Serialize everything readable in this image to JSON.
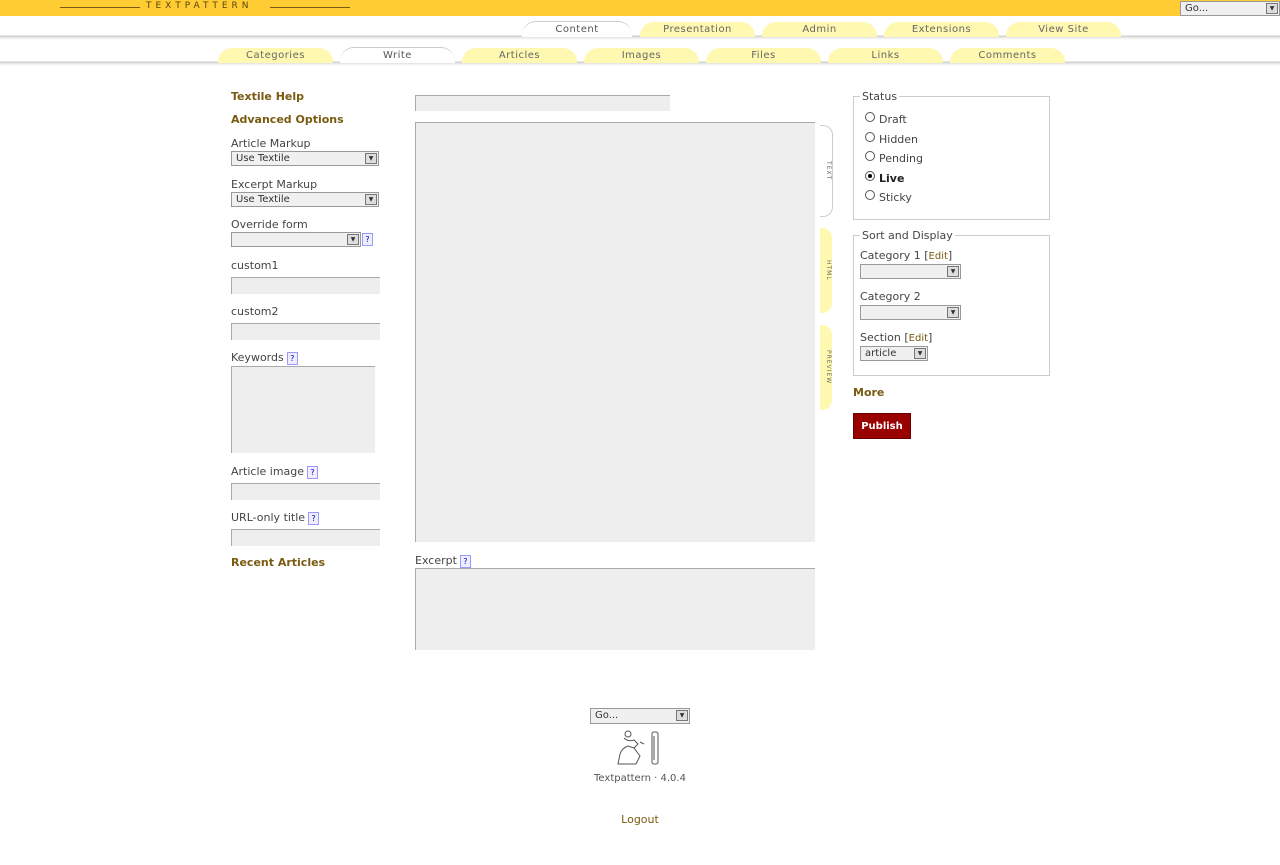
{
  "brand": "Textpattern",
  "top_go": "Go...",
  "tabs_primary": [
    {
      "label": "Content",
      "active": true
    },
    {
      "label": "Presentation"
    },
    {
      "label": "Admin"
    },
    {
      "label": "Extensions"
    },
    {
      "label": "View Site"
    }
  ],
  "tabs_secondary": [
    {
      "label": "Categories"
    },
    {
      "label": "Write",
      "active": true
    },
    {
      "label": "Articles"
    },
    {
      "label": "Images"
    },
    {
      "label": "Files"
    },
    {
      "label": "Links"
    },
    {
      "label": "Comments"
    }
  ],
  "left": {
    "textile_help": "Textile Help",
    "advanced_options": "Advanced Options",
    "article_markup_label": "Article Markup",
    "article_markup_value": "Use Textile",
    "excerpt_markup_label": "Excerpt Markup",
    "excerpt_markup_value": "Use Textile",
    "override_form_label": "Override form",
    "override_form_value": "",
    "custom1_label": "custom1",
    "custom2_label": "custom2",
    "keywords_label": "Keywords",
    "article_image_label": "Article image",
    "url_title_label": "URL-only title",
    "recent_articles": "Recent Articles",
    "help": "?"
  },
  "editor": {
    "title_value": "",
    "body_value": "",
    "excerpt_label": "Excerpt",
    "excerpt_value": "",
    "view_tabs": [
      {
        "label": "TEXT",
        "active": true
      },
      {
        "label": "HTML"
      },
      {
        "label": "PREVIEW"
      }
    ]
  },
  "status": {
    "legend": "Status",
    "options": [
      {
        "label": "Draft",
        "checked": false
      },
      {
        "label": "Hidden",
        "checked": false
      },
      {
        "label": "Pending",
        "checked": false
      },
      {
        "label": "Live",
        "checked": true
      },
      {
        "label": "Sticky",
        "checked": false
      }
    ]
  },
  "sort": {
    "legend": "Sort and Display",
    "category1_label": "Category 1",
    "category2_label": "Category 2",
    "section_label": "Section",
    "edit": "Edit",
    "category1_value": "",
    "category2_value": "",
    "section_value": "article"
  },
  "more": "More",
  "publish": "Publish",
  "footer": {
    "go": "Go...",
    "version": "Textpattern · 4.0.4",
    "logout": "Logout"
  },
  "colors": {
    "topbar": "#ffcc33",
    "tab": "#fff8b0",
    "publish": "#990000",
    "heading": "#7a5a10"
  }
}
